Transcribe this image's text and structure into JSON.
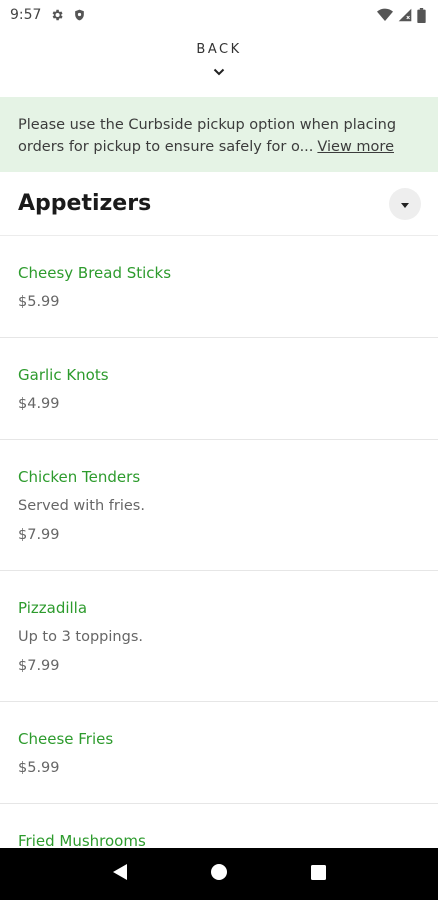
{
  "status_bar": {
    "time": "9:57",
    "left_icons": [
      "gear-icon",
      "shield-icon"
    ],
    "right_icons": [
      "wifi-icon",
      "signal-icon",
      "battery-icon"
    ]
  },
  "header": {
    "back_label": "BACK"
  },
  "notice": {
    "line1": "Please use the Curbside pickup option when placing",
    "line2": "orders for pickup to ensure safely for o...",
    "view_more_label": "View more",
    "background_color": "#e5f3e5"
  },
  "section": {
    "title": "Appetizers"
  },
  "menu_items": [
    {
      "name": "Cheesy Bread Sticks",
      "description": "",
      "price": "$5.99"
    },
    {
      "name": "Garlic Knots",
      "description": "",
      "price": "$4.99"
    },
    {
      "name": "Chicken Tenders",
      "description": "Served with fries.",
      "price": "$7.99"
    },
    {
      "name": "Pizzadilla",
      "description": "Up to 3 toppings.",
      "price": "$7.99"
    },
    {
      "name": "Cheese Fries",
      "description": "",
      "price": "$5.99"
    },
    {
      "name": "Fried Mushrooms",
      "description": "",
      "price": ""
    }
  ],
  "colors": {
    "accent_green": "#2d9b2d",
    "nav_bar": "#000000"
  },
  "nav_bar": {
    "buttons": [
      "back-triangle-icon",
      "home-circle-icon",
      "recents-square-icon"
    ]
  }
}
